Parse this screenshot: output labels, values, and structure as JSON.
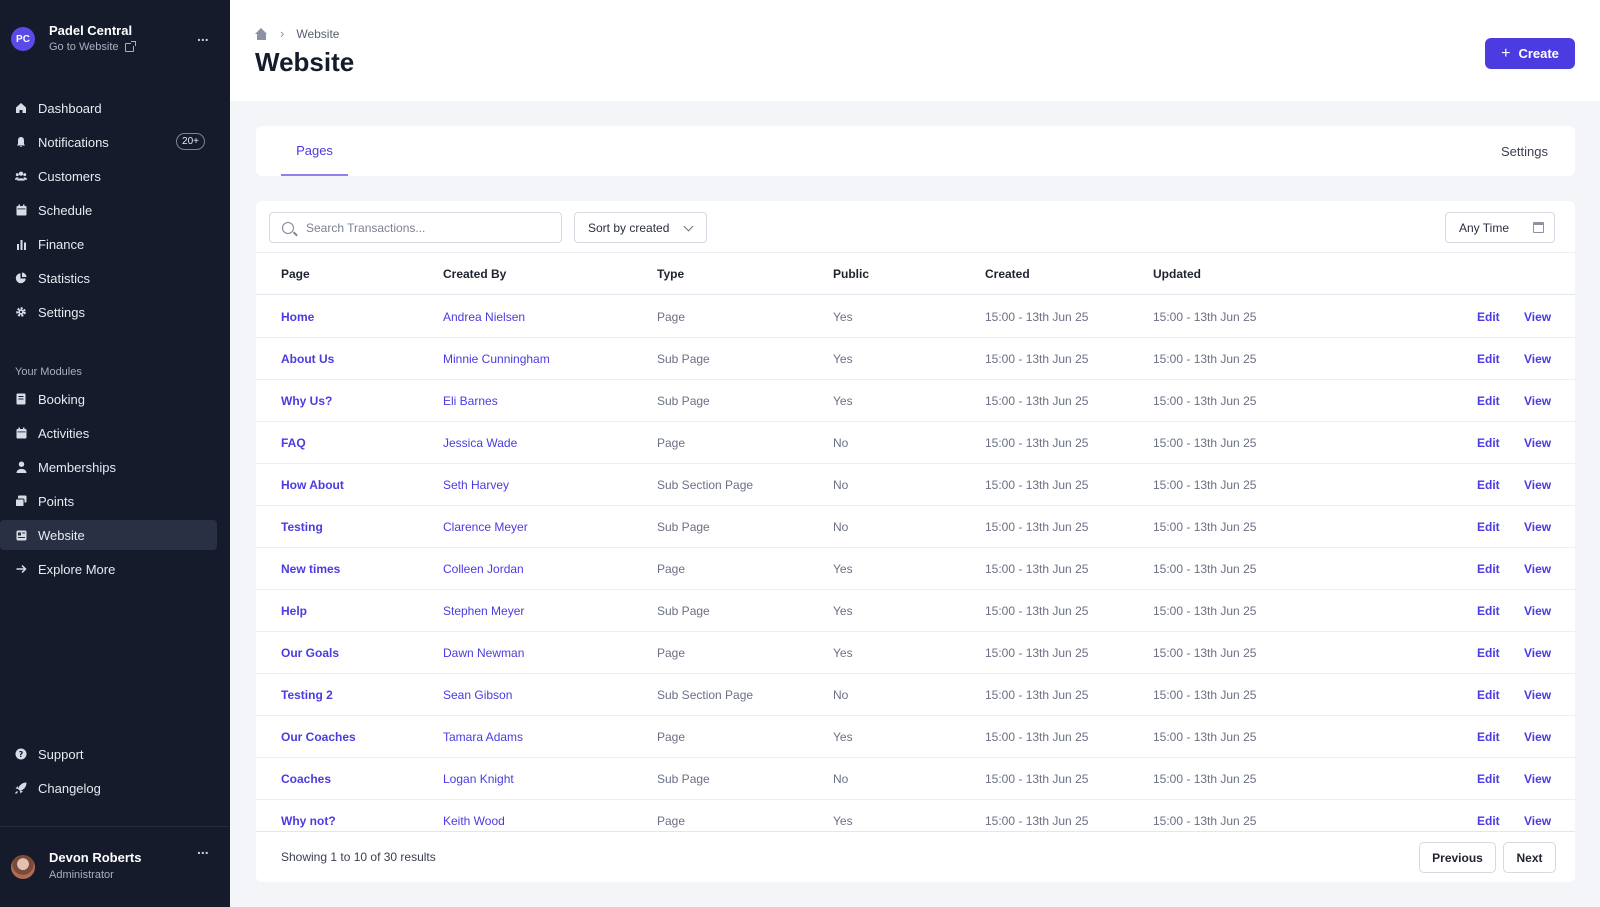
{
  "org": {
    "initials": "PC",
    "name": "Padel Central",
    "link": "Go to Website",
    "menu": "..."
  },
  "nav": {
    "main": [
      {
        "label": "Dashboard",
        "icon": "home-icon"
      },
      {
        "label": "Notifications",
        "icon": "bell-icon",
        "badge": "20+"
      },
      {
        "label": "Customers",
        "icon": "users-icon"
      },
      {
        "label": "Schedule",
        "icon": "calendar-icon"
      },
      {
        "label": "Finance",
        "icon": "bar-chart-icon"
      },
      {
        "label": "Statistics",
        "icon": "pie-chart-icon"
      },
      {
        "label": "Settings",
        "icon": "gear-icon"
      }
    ],
    "modules_label": "Your Modules",
    "modules": [
      {
        "label": "Booking",
        "icon": "book-icon"
      },
      {
        "label": "Activities",
        "icon": "calendar-icon"
      },
      {
        "label": "Memberships",
        "icon": "user-icon"
      },
      {
        "label": "Points",
        "icon": "points-icon"
      },
      {
        "label": "Website",
        "icon": "website-icon",
        "active": true
      },
      {
        "label": "Explore More",
        "icon": "arrow-right-icon"
      }
    ],
    "bottom": [
      {
        "label": "Support",
        "icon": "help-icon"
      },
      {
        "label": "Changelog",
        "icon": "rocket-icon"
      }
    ]
  },
  "user": {
    "name": "Devon Roberts",
    "role": "Administrator",
    "menu": "..."
  },
  "breadcrumb": {
    "current": "Website"
  },
  "page": {
    "title": "Website",
    "create_label": "Create"
  },
  "tabs": {
    "pages": "Pages",
    "settings": "Settings"
  },
  "toolbar": {
    "search_placeholder": "Search Transactions...",
    "sort_label": "Sort by created",
    "time_label": "Any Time"
  },
  "table": {
    "headers": {
      "page": "Page",
      "created_by": "Created By",
      "type": "Type",
      "public": "Public",
      "created": "Created",
      "updated": "Updated"
    },
    "edit_label": "Edit",
    "view_label": "View",
    "rows": [
      {
        "page": "Home",
        "created_by": "Andrea Nielsen",
        "type": "Page",
        "public": "Yes",
        "created": "15:00 - 13th Jun 25",
        "updated": "15:00 - 13th Jun 25"
      },
      {
        "page": "About Us",
        "created_by": "Minnie Cunningham",
        "type": "Sub Page",
        "public": "Yes",
        "created": "15:00 - 13th Jun 25",
        "updated": "15:00 - 13th Jun 25"
      },
      {
        "page": "Why Us?",
        "created_by": "Eli Barnes",
        "type": "Sub Page",
        "public": "Yes",
        "created": "15:00 - 13th Jun 25",
        "updated": "15:00 - 13th Jun 25"
      },
      {
        "page": "FAQ",
        "created_by": "Jessica Wade",
        "type": "Page",
        "public": "No",
        "created": "15:00 - 13th Jun 25",
        "updated": "15:00 - 13th Jun 25"
      },
      {
        "page": "How About",
        "created_by": "Seth Harvey",
        "type": "Sub Section Page",
        "public": "No",
        "created": "15:00 - 13th Jun 25",
        "updated": "15:00 - 13th Jun 25"
      },
      {
        "page": "Testing",
        "created_by": "Clarence Meyer",
        "type": "Sub Page",
        "public": "No",
        "created": "15:00 - 13th Jun 25",
        "updated": "15:00 - 13th Jun 25"
      },
      {
        "page": "New times",
        "created_by": "Colleen Jordan",
        "type": "Page",
        "public": "Yes",
        "created": "15:00 - 13th Jun 25",
        "updated": "15:00 - 13th Jun 25"
      },
      {
        "page": "Help",
        "created_by": "Stephen Meyer",
        "type": "Sub Page",
        "public": "Yes",
        "created": "15:00 - 13th Jun 25",
        "updated": "15:00 - 13th Jun 25"
      },
      {
        "page": "Our Goals",
        "created_by": "Dawn Newman",
        "type": "Page",
        "public": "Yes",
        "created": "15:00 - 13th Jun 25",
        "updated": "15:00 - 13th Jun 25"
      },
      {
        "page": "Testing 2",
        "created_by": "Sean Gibson",
        "type": "Sub Section Page",
        "public": "No",
        "created": "15:00 - 13th Jun 25",
        "updated": "15:00 - 13th Jun 25"
      },
      {
        "page": "Our Coaches",
        "created_by": "Tamara Adams",
        "type": "Page",
        "public": "Yes",
        "created": "15:00 - 13th Jun 25",
        "updated": "15:00 - 13th Jun 25"
      },
      {
        "page": "Coaches",
        "created_by": "Logan Knight",
        "type": "Sub Page",
        "public": "No",
        "created": "15:00 - 13th Jun 25",
        "updated": "15:00 - 13th Jun 25"
      },
      {
        "page": "Why not?",
        "created_by": "Keith Wood",
        "type": "Page",
        "public": "Yes",
        "created": "15:00 - 13th Jun 25",
        "updated": "15:00 - 13th Jun 25"
      }
    ]
  },
  "pagination": {
    "summary": "Showing 1 to 10 of 30 results",
    "previous": "Previous",
    "next": "Next"
  },
  "colors": {
    "accent": "#4b3be0",
    "sidebar": "#161b2b"
  }
}
